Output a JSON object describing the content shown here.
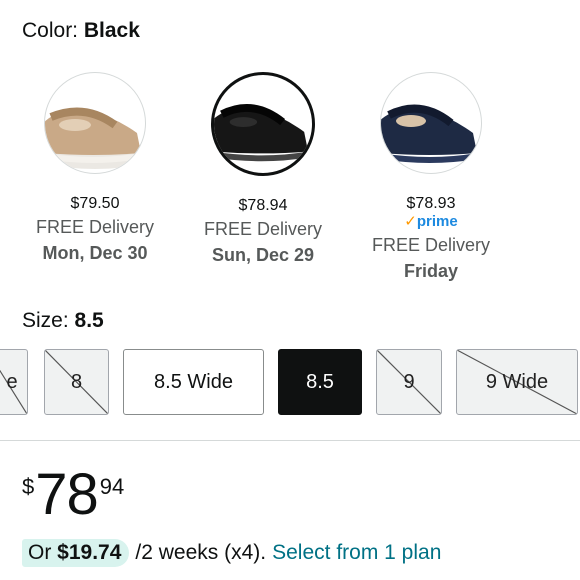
{
  "color": {
    "label": "Color:",
    "value": "Black"
  },
  "swatches": [
    {
      "name": "Tan",
      "price": "$79.50",
      "prime": "",
      "delivery": "FREE Delivery",
      "date": "Mon, Dec 30",
      "selected": false,
      "shoe_color": "#c9a987"
    },
    {
      "name": "Black",
      "price": "$78.94",
      "prime": "",
      "delivery": "FREE Delivery",
      "date": "Sun, Dec 29",
      "selected": true,
      "shoe_color": "#161616"
    },
    {
      "name": "Navy",
      "price": "$78.93",
      "prime": "prime",
      "delivery": "FREE Delivery",
      "date": "Friday",
      "selected": false,
      "shoe_color": "#1e2a44"
    }
  ],
  "size": {
    "label": "Size:",
    "value": "8.5",
    "options": [
      {
        "label": "e",
        "available": false,
        "selected": false
      },
      {
        "label": "8",
        "available": false,
        "selected": false
      },
      {
        "label": "8.5 Wide",
        "available": true,
        "selected": false
      },
      {
        "label": "8.5",
        "available": true,
        "selected": true
      },
      {
        "label": "9",
        "available": false,
        "selected": false
      },
      {
        "label": "9 Wide",
        "available": false,
        "selected": false
      }
    ]
  },
  "price": {
    "symbol": "$",
    "whole": "78",
    "fraction": "94"
  },
  "plan": {
    "prefix": "Or",
    "amount": "$19.74",
    "term": "/2 weeks (x4).",
    "link": "Select from 1 plan"
  },
  "colors": {
    "link": "#007185",
    "prime": "#1d8ae0",
    "pill": "#d8f3ee"
  }
}
